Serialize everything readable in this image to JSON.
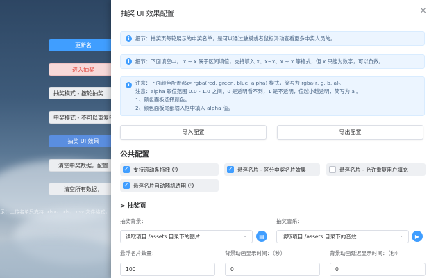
{
  "background": {
    "buttons": [
      {
        "label": "更新名"
      },
      {
        "label": "进入抽奖"
      },
      {
        "label": "抽奖模式 - 按轮抽奖"
      },
      {
        "label": "中奖模式 - 不可以重复中"
      },
      {
        "label": "抽奖 UI 效果"
      },
      {
        "label": "清空中奖数据，配置"
      },
      {
        "label": "清空所有数据，"
      }
    ],
    "hint": "示：上传名单只支持 .xlsx、.xls、.csv 文件格式，"
  },
  "dialog": {
    "title": "抽奖 UI 效果配置",
    "close_icon": "×",
    "alerts": [
      {
        "lines": [
          "细节：抽奖页每轮展示的中奖名单，是可以通过触摸或者鼠标滑动查看更多中奖人员的。"
        ]
      },
      {
        "lines": [
          "细节：下面填空中， x ~ x 属于区间填值，支持填入 x、x~x、x ~ x 等格式，但 x 只能为数字，可以负数。"
        ]
      },
      {
        "lines": [
          "注意：下面颜色配置都走 rgba(red, green, blue, alpha) 模式，简写为 rgba(r, g, b, a)。",
          "注意：alpha 取值范围 0.0 - 1.0 之间，0 是透明看不到，1 是不透明，值越小越透明，简写为 a 。",
          "1、颜色面板选择颜色。",
          "2、颜色面板尾部输入框中填入 alpha 值。"
        ]
      }
    ],
    "import_label": "导入配置",
    "export_label": "导出配置",
    "public_section": "公共配置",
    "checkboxes": [
      {
        "label": "支持滚动条拖拽",
        "checked": true
      },
      {
        "label": "悬浮名片 - 区分中奖名片效果",
        "checked": true
      },
      {
        "label": "悬浮名片 - 允许重复用户填充",
        "checked": false
      },
      {
        "label": "悬浮名片自动随机透明",
        "checked": true
      }
    ],
    "lottery_section": "> 抽奖页",
    "bg_label": "抽奖背景：",
    "bg_value": "读取项目 /assets 目录下的图片",
    "music_label": "抽奖音乐：",
    "music_value": "读取项目 /assets 目录下的音效",
    "count_label": "悬浮名片数量：",
    "count_value": "100",
    "bg_anim_label": "背景动画显示时间：（秒）",
    "bg_anim_value": "0",
    "bg_delay_label": "背景动画延迟显示时间：（秒）",
    "bg_delay_value": "0"
  },
  "colors": {
    "primary": "#409eff",
    "alert_bg": "#ecf5ff"
  }
}
